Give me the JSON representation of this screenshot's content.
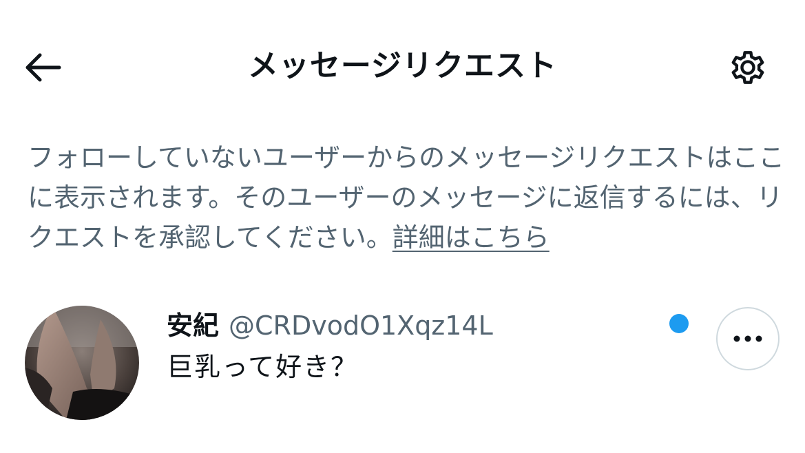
{
  "header": {
    "title": "メッセージリクエスト",
    "back_icon": "arrow-left-icon",
    "settings_icon": "gear-icon"
  },
  "info": {
    "text": "フォローしていないユーザーからのメッセージリクエストはここに表示されます。そのユーザーのメッセージに返信するには、リクエストを承認してください。",
    "link_label": "詳細はこちら"
  },
  "requests": [
    {
      "display_name": "安紀",
      "handle": "@CRDvodO1Xqz14L",
      "message": "巨乳って好き？",
      "unread": true,
      "more_icon": "more-horizontal-icon"
    }
  ],
  "colors": {
    "text_primary": "#0f1419",
    "text_secondary": "#536471",
    "accent": "#1d9bf0",
    "border": "#cfd9de"
  }
}
